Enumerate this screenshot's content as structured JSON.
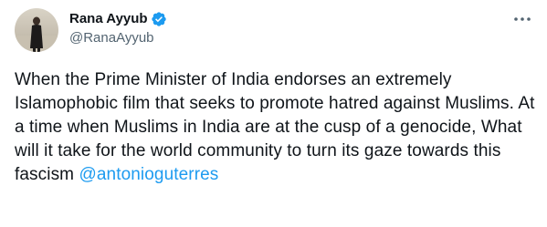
{
  "author": {
    "display_name": "Rana Ayyub",
    "handle": "@RanaAyyub",
    "verified": true,
    "avatar_icon": "profile-photo"
  },
  "menu_icon": "more-options-icon",
  "tweet": {
    "text": "When the Prime Minister of India endorses an extremely Islamophobic film that seeks to promote hatred against Muslims. At a time when Muslims in India are at the cusp of a genocide, What will it take for the world community to turn its gaze towards this fascism ",
    "mention": "@antonioguterres"
  },
  "colors": {
    "text": "#0f1419",
    "secondary_text": "#536471",
    "accent": "#1d9bf0",
    "background": "#ffffff"
  }
}
